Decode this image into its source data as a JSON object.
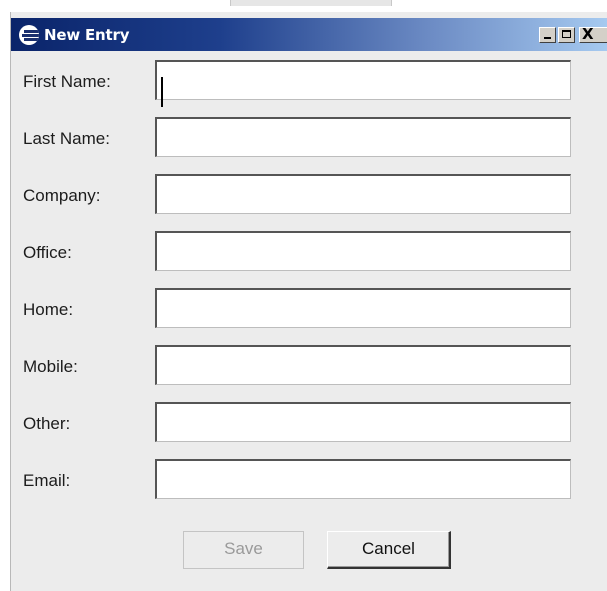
{
  "window": {
    "title": "New Entry",
    "controls": {
      "minimize_icon": "minimize-icon",
      "maximize_icon": "maximize-icon",
      "close_icon": "close-icon",
      "close_glyph": "X"
    }
  },
  "form": {
    "fields": [
      {
        "label": "First Name:",
        "value": "",
        "placeholder": ""
      },
      {
        "label": "Last Name:",
        "value": "",
        "placeholder": ""
      },
      {
        "label": "Company:",
        "value": "",
        "placeholder": ""
      },
      {
        "label": "Office:",
        "value": "",
        "placeholder": ""
      },
      {
        "label": "Home:",
        "value": "",
        "placeholder": ""
      },
      {
        "label": "Mobile:",
        "value": "",
        "placeholder": ""
      },
      {
        "label": "Other:",
        "value": "",
        "placeholder": ""
      },
      {
        "label": "Email:",
        "value": "",
        "placeholder": ""
      }
    ]
  },
  "buttons": {
    "save_label": "Save",
    "save_enabled": false,
    "cancel_label": "Cancel"
  },
  "colors": {
    "titlebar_start": "#0a246a",
    "titlebar_end": "#a6caf0",
    "window_bg": "#ececec",
    "disabled_text": "#9a9a9a"
  }
}
